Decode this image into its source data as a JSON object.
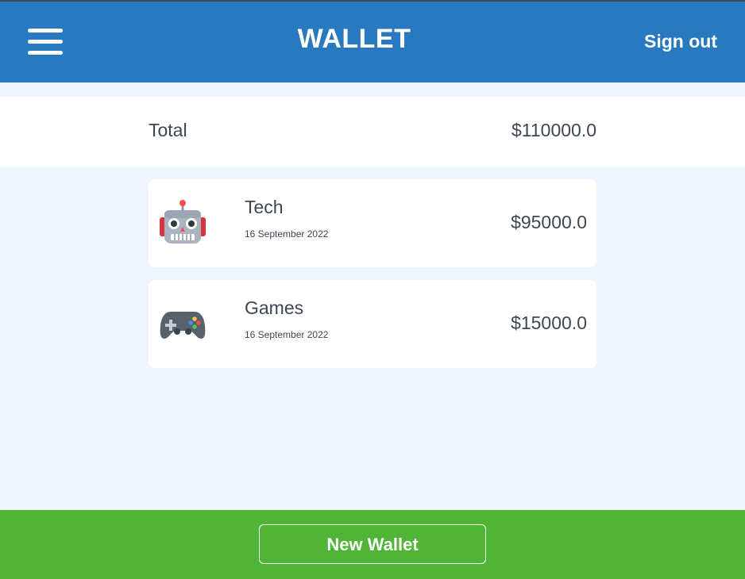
{
  "header": {
    "title": "WALLET",
    "menu_icon": "hamburger-menu-icon",
    "signout_label": "Sign out"
  },
  "total": {
    "label": "Total",
    "value": "$110000.0"
  },
  "wallets": [
    {
      "icon": "robot-icon",
      "name": "Tech",
      "date": "16 September 2022",
      "amount": "$95000.0"
    },
    {
      "icon": "game-controller-icon",
      "name": "Games",
      "date": "16 September 2022",
      "amount": "$15000.0"
    }
  ],
  "footer": {
    "new_wallet_label": "New Wallet"
  },
  "colors": {
    "header": "#2879bf",
    "background": "#eef5fd",
    "footer": "#50b537",
    "text": "#3d4652"
  }
}
